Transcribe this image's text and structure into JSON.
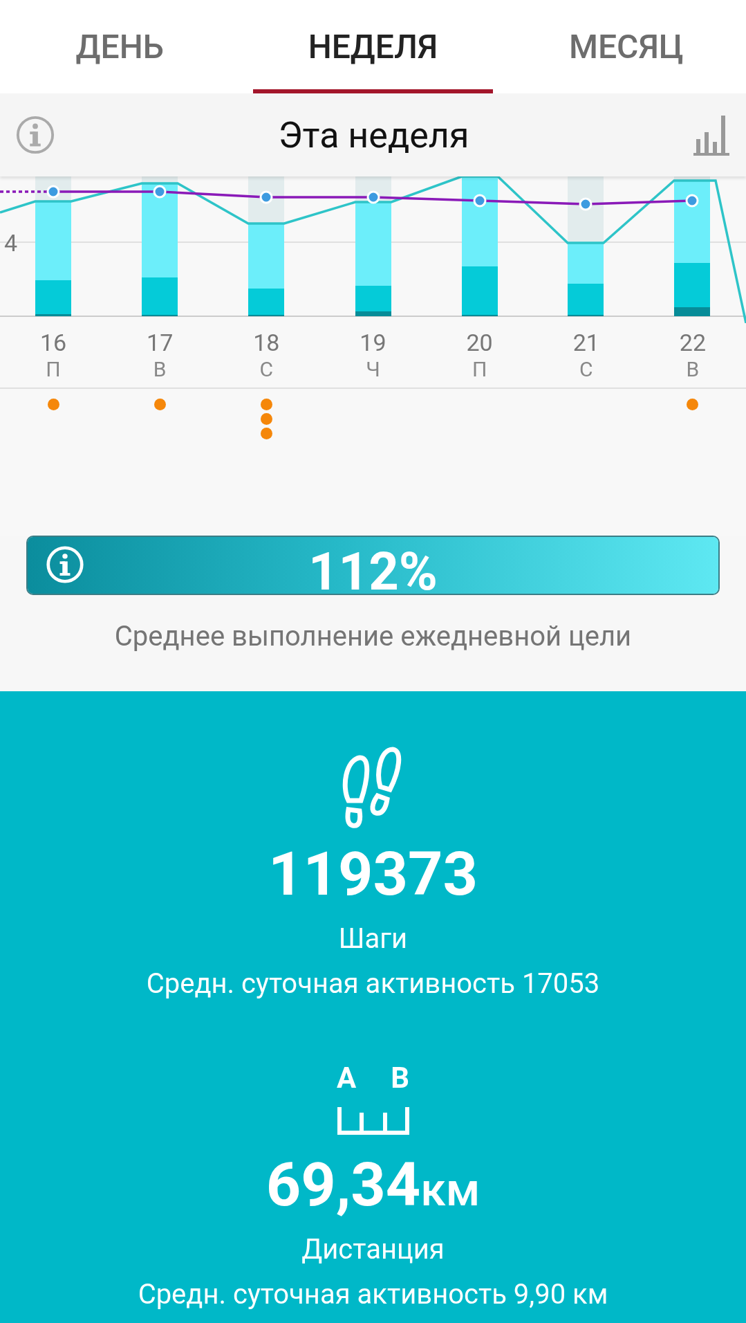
{
  "tabs": [
    {
      "label": "ДЕНЬ",
      "selected": false
    },
    {
      "label": "НЕДЕЛЯ",
      "selected": true
    },
    {
      "label": "МЕСЯЦ",
      "selected": false
    }
  ],
  "header": {
    "title": "Эта неделя"
  },
  "chart": {
    "y_tick_label": "4",
    "days": [
      {
        "date": "16",
        "weekday": "П"
      },
      {
        "date": "17",
        "weekday": "В"
      },
      {
        "date": "18",
        "weekday": "С"
      },
      {
        "date": "19",
        "weekday": "Ч"
      },
      {
        "date": "20",
        "weekday": "П"
      },
      {
        "date": "21",
        "weekday": "С"
      },
      {
        "date": "22",
        "weekday": "В"
      }
    ]
  },
  "goal": {
    "level": 1,
    "percent": "112%",
    "caption": "Среднее выполнение ежедневной цели"
  },
  "steps": {
    "value": "119373",
    "label": "Шаги",
    "average": "Средн. суточная активность 17053"
  },
  "distance": {
    "marker_a": "A",
    "marker_b": "B",
    "value": "69,34",
    "unit": "км",
    "label": "Дистанция",
    "average": "Средн. суточная активность 9,90 км"
  }
}
